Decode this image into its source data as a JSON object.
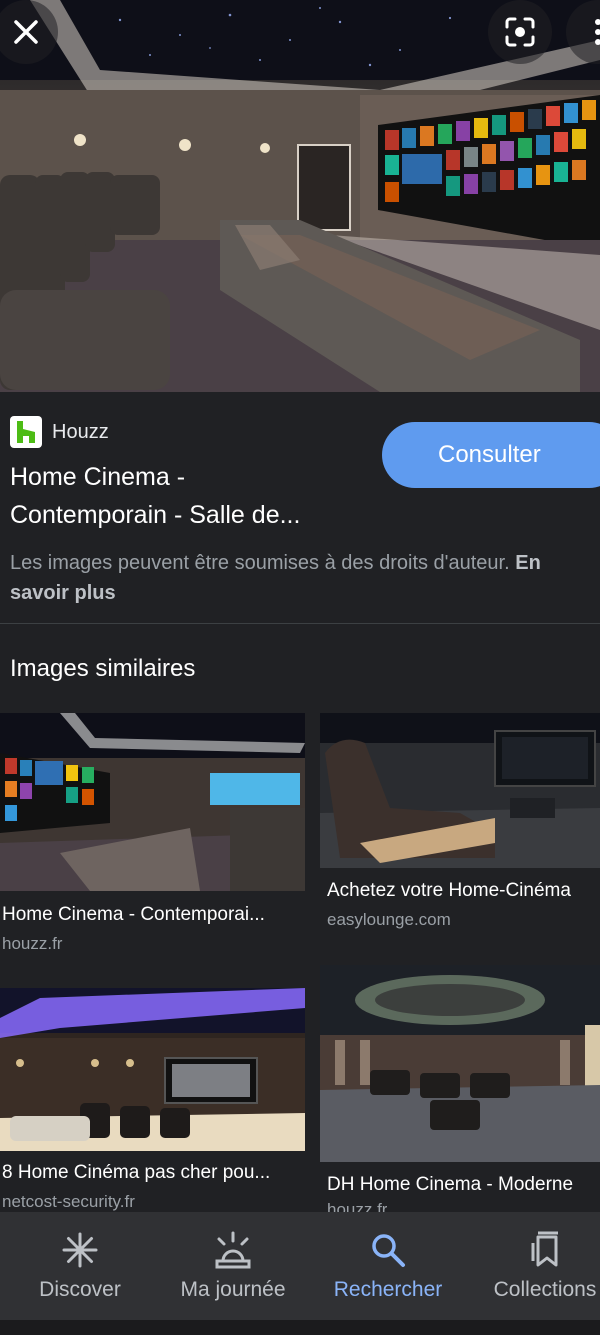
{
  "hero": {
    "alt": "Home cinema room"
  },
  "source": {
    "name": "Houzz"
  },
  "result": {
    "title_line1": "Home Cinema -",
    "title_line2": "Contemporain - Salle de...",
    "consult_label": "Consulter"
  },
  "rights": {
    "text": "Les images peuvent être soumises à des droits d'auteur.",
    "link": "En savoir plus"
  },
  "similar": {
    "heading": "Images similaires",
    "items": [
      {
        "title": "Home Cinema - Contemporai...",
        "source": "houzz.fr"
      },
      {
        "title": "Achetez votre Home-Cinéma",
        "source": "easylounge.com"
      },
      {
        "title": "8 Home Cinéma pas cher pou...",
        "source": "netcost-security.fr"
      },
      {
        "title": "DH Home Cinema - Moderne",
        "source": "houzz.fr"
      }
    ]
  },
  "nav": {
    "items": [
      {
        "label": "Discover",
        "icon": "asterisk-icon"
      },
      {
        "label": "Ma journée",
        "icon": "sunrise-icon"
      },
      {
        "label": "Rechercher",
        "icon": "search-icon"
      },
      {
        "label": "Collections",
        "icon": "bookmarks-icon"
      }
    ],
    "active": "Rechercher"
  },
  "colors": {
    "accent": "#8ab4f8",
    "button": "#5f9bef",
    "background": "#202124",
    "brand_houzz": "#4dbc15"
  }
}
